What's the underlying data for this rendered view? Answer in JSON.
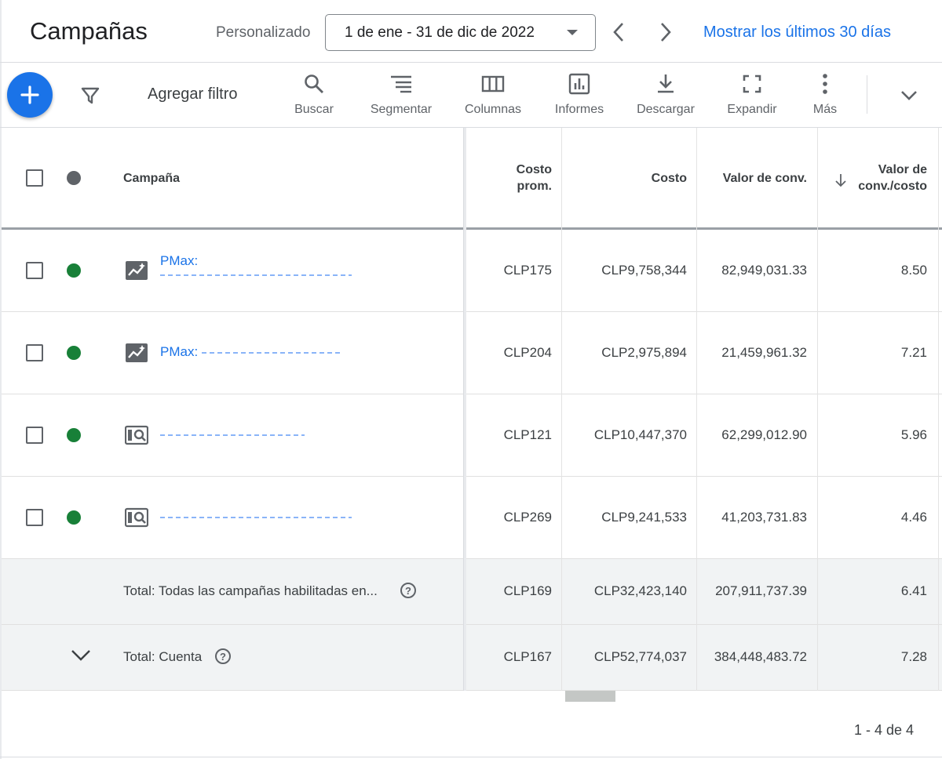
{
  "header": {
    "title": "Campañas",
    "date_preset": "Personalizado",
    "date_range": "1 de ene - 31 de dic de 2022",
    "show_last_link": "Mostrar los últimos 30 días"
  },
  "toolbar": {
    "add_filter": "Agregar filtro",
    "tools": [
      {
        "label": "Buscar",
        "icon": "search-icon"
      },
      {
        "label": "Segmentar",
        "icon": "segment-icon"
      },
      {
        "label": "Columnas",
        "icon": "columns-icon"
      },
      {
        "label": "Informes",
        "icon": "reports-icon"
      },
      {
        "label": "Descargar",
        "icon": "download-icon"
      },
      {
        "label": "Expandir",
        "icon": "expand-icon"
      },
      {
        "label": "Más",
        "icon": "more-vert-icon"
      }
    ]
  },
  "table": {
    "columns": {
      "campaign": "Campaña",
      "avg_cost_1": "Costo",
      "avg_cost_2": "prom.",
      "cost": "Costo",
      "conv_value": "Valor de conv.",
      "conv_value_cost_1": "Valor de",
      "conv_value_cost_2": "conv./costo"
    },
    "rows": [
      {
        "name": "PMax:",
        "type_icon": "performance-max-icon",
        "status_color": "#188038",
        "avg_cost": "CLP175",
        "cost": "CLP9,758,344",
        "conv_value": "82,949,031.33",
        "conv_value_cost": "8.50"
      },
      {
        "name": "PMax:",
        "type_icon": "performance-max-icon",
        "status_color": "#188038",
        "avg_cost": "CLP204",
        "cost": "CLP2,975,894",
        "conv_value": "21,459,961.32",
        "conv_value_cost": "7.21"
      },
      {
        "name": "",
        "type_icon": "search-campaign-icon",
        "status_color": "#188038",
        "avg_cost": "CLP121",
        "cost": "CLP10,447,370",
        "conv_value": "62,299,012.90",
        "conv_value_cost": "5.96"
      },
      {
        "name": "",
        "type_icon": "search-campaign-icon",
        "status_color": "#188038",
        "avg_cost": "CLP269",
        "cost": "CLP9,241,533",
        "conv_value": "41,203,731.83",
        "conv_value_cost": "4.46"
      }
    ],
    "totals": [
      {
        "label": "Total: Todas las campañas habilitadas en...",
        "avg_cost": "CLP169",
        "cost": "CLP32,423,140",
        "conv_value": "207,911,737.39",
        "conv_value_cost": "6.41"
      },
      {
        "label": "Total: Cuenta",
        "avg_cost": "CLP167",
        "cost": "CLP52,774,037",
        "conv_value": "384,448,483.72",
        "conv_value_cost": "7.28"
      }
    ]
  },
  "pagination": "1 - 4 de 4",
  "colors": {
    "accent": "#1a73e8",
    "status_enabled": "#188038",
    "status_header": "#5f6368"
  }
}
